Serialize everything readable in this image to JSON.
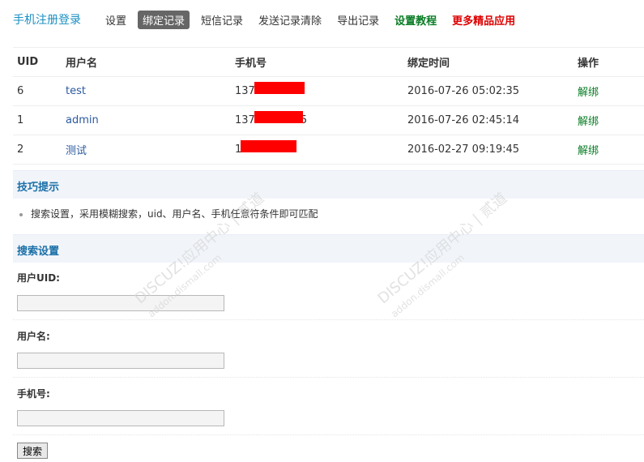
{
  "header": {
    "title": "手机注册登录",
    "nav": [
      {
        "label": "设置"
      },
      {
        "label": "绑定记录"
      },
      {
        "label": "短信记录"
      },
      {
        "label": "发送记录清除"
      },
      {
        "label": "导出记录"
      },
      {
        "label": "设置教程"
      },
      {
        "label": "更多精品应用"
      }
    ]
  },
  "table": {
    "columns": [
      "UID",
      "用户名",
      "手机号",
      "绑定时间",
      "操作"
    ],
    "rows": [
      {
        "uid": "6",
        "username": "test",
        "phone": "137",
        "time": "2016-07-26 05:02:35",
        "action": "解绑"
      },
      {
        "uid": "1",
        "username": "admin",
        "phone": "137",
        "phone_tail": "5",
        "time": "2016-07-26 02:45:14",
        "action": "解绑"
      },
      {
        "uid": "2",
        "username": "测试",
        "phone": "1",
        "time": "2016-02-27 09:19:45",
        "action": "解绑"
      }
    ]
  },
  "tips": {
    "title": "技巧提示",
    "items": [
      "搜索设置，采用模糊搜索，uid、用户名、手机任意符条件即可匹配"
    ]
  },
  "search": {
    "title": "搜索设置",
    "uid_label": "用户UID:",
    "username_label": "用户名:",
    "phone_label": "手机号:",
    "button_label": "搜索"
  },
  "watermark": {
    "text_1": "DISCUZ!应用中心 | 贰道",
    "text_2": "addon.dismall.com"
  },
  "colors": {
    "accent": "#1a8fc1",
    "link_green": "#097c25",
    "link_red": "#dd0000",
    "mask_red": "#ff0000",
    "section_bg": "#f1f5fa"
  }
}
